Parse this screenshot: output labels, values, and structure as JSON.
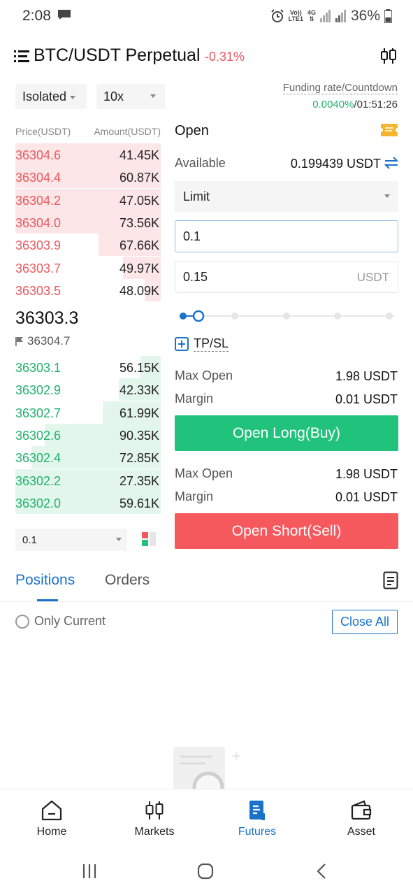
{
  "status_bar": {
    "time": "2:08",
    "volte_top": "Vo))",
    "volte_bottom": "LTE1",
    "network": "4G",
    "battery": "36%"
  },
  "header": {
    "pair": "BTC/USDT Perpetual",
    "change": "-0.31%"
  },
  "controls": {
    "margin_mode": "Isolated",
    "leverage": "10x",
    "funding_label": "Funding rate/Countdown",
    "funding_rate": "0.0040%",
    "countdown": "/01:51:26"
  },
  "order_book": {
    "price_header": "Price(USDT)",
    "amount_header": "Amount(USDT)",
    "asks": [
      {
        "price": "36304.6",
        "amount": "41.45K",
        "depth": 1.0
      },
      {
        "price": "36304.4",
        "amount": "60.87K",
        "depth": 1.0
      },
      {
        "price": "36304.2",
        "amount": "47.05K",
        "depth": 1.0
      },
      {
        "price": "36304.0",
        "amount": "73.56K",
        "depth": 1.0
      },
      {
        "price": "36303.9",
        "amount": "67.66K",
        "depth": 0.43
      },
      {
        "price": "36303.7",
        "amount": "49.97K",
        "depth": 0.26
      },
      {
        "price": "36303.5",
        "amount": "48.09K",
        "depth": 0.11
      }
    ],
    "last_price": "36303.3",
    "mark_price": "36304.7",
    "bids": [
      {
        "price": "36303.1",
        "amount": "56.15K",
        "depth": 0.14
      },
      {
        "price": "36302.9",
        "amount": "42.33K",
        "depth": 0.29
      },
      {
        "price": "36302.7",
        "amount": "61.99K",
        "depth": 0.4
      },
      {
        "price": "36302.6",
        "amount": "90.35K",
        "depth": 0.8
      },
      {
        "price": "36302.4",
        "amount": "72.85K",
        "depth": 0.89
      },
      {
        "price": "36302.2",
        "amount": "27.35K",
        "depth": 1.0
      },
      {
        "price": "36302.0",
        "amount": "59.61K",
        "depth": 1.0
      }
    ],
    "depth_step": "0.1"
  },
  "form": {
    "title": "Open",
    "available_label": "Available",
    "available_value": "0.199439 USDT",
    "order_type": "Limit",
    "price_value": "0.1",
    "amount_value": "0.15",
    "amount_unit": "USDT",
    "slider_percent": 0,
    "tpsl_label": "TP/SL",
    "long": {
      "max_open_label": "Max Open",
      "max_open_value": "1.98 USDT",
      "margin_label": "Margin",
      "margin_value": "0.01 USDT",
      "button": "Open Long(Buy)"
    },
    "short": {
      "max_open_label": "Max Open",
      "max_open_value": "1.98 USDT",
      "margin_label": "Margin",
      "margin_value": "0.01 USDT",
      "button": "Open Short(Sell)"
    }
  },
  "tabs": {
    "positions": "Positions",
    "orders": "Orders",
    "only_current": "Only Current",
    "close_all": "Close All"
  },
  "bottom_nav": [
    {
      "label": "Home",
      "icon": "home-icon"
    },
    {
      "label": "Markets",
      "icon": "candlestick-icon"
    },
    {
      "label": "Futures",
      "icon": "futures-doc-icon",
      "active": true
    },
    {
      "label": "Asset",
      "icon": "wallet-icon"
    }
  ],
  "colors": {
    "accent": "#1a73c9",
    "buy": "#20c27c",
    "sell": "#f5585d",
    "ask_text": "#e8595f",
    "bid_text": "#20b26c"
  }
}
